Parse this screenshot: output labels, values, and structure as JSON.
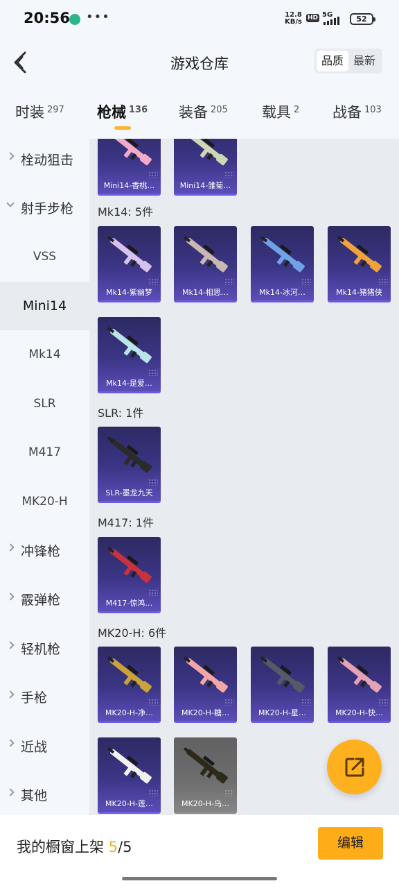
{
  "status_bar": {
    "time": "20:56",
    "speed_value": "12.8",
    "speed_unit": "KB/s",
    "hd": "HD",
    "network": "5G",
    "battery": "52"
  },
  "header": {
    "title": "游戏仓库",
    "sort_options": [
      "品质",
      "最新"
    ],
    "sort_selected": "品质"
  },
  "tabs": [
    {
      "label": "时装",
      "count": "297"
    },
    {
      "label": "枪械",
      "count": "136"
    },
    {
      "label": "装备",
      "count": "205"
    },
    {
      "label": "载具",
      "count": "2"
    },
    {
      "label": "战备",
      "count": "103"
    }
  ],
  "active_tab": "枪械",
  "sidebar": {
    "items": [
      {
        "label": "栓动狙击",
        "type": "category",
        "expanded": false
      },
      {
        "label": "射手步枪",
        "type": "category",
        "expanded": true
      },
      {
        "label": "VSS",
        "type": "sub"
      },
      {
        "label": "Mini14",
        "type": "sub",
        "selected": true
      },
      {
        "label": "Mk14",
        "type": "sub"
      },
      {
        "label": "SLR",
        "type": "sub"
      },
      {
        "label": "M417",
        "type": "sub"
      },
      {
        "label": "MK20-H",
        "type": "sub"
      },
      {
        "label": "冲锋枪",
        "type": "category",
        "expanded": false
      },
      {
        "label": "霰弹枪",
        "type": "category",
        "expanded": false
      },
      {
        "label": "轻机枪",
        "type": "category",
        "expanded": false
      },
      {
        "label": "手枪",
        "type": "category",
        "expanded": false
      },
      {
        "label": "近战",
        "type": "category",
        "expanded": false
      },
      {
        "label": "其他",
        "type": "category",
        "expanded": false
      }
    ]
  },
  "groups": [
    {
      "title": "",
      "items": [
        {
          "label": "Mini14-香桃…",
          "color": "#f3a9c7"
        },
        {
          "label": "Mini14-雏菊…",
          "color": "#cfd6b6"
        }
      ]
    },
    {
      "title": "Mk14: 5件",
      "items": [
        {
          "label": "Mk14-紫幽梦",
          "color": "#d7c2ee"
        },
        {
          "label": "Mk14-相思…",
          "color": "#c9b8b2"
        },
        {
          "label": "Mk14-冰河…",
          "color": "#6fa3e6"
        },
        {
          "label": "Mk14-猪猪侠",
          "color": "#f0a23c"
        },
        {
          "label": "Mk14-是爱…",
          "color": "#b8e4ea"
        }
      ]
    },
    {
      "title": "SLR: 1件",
      "items": [
        {
          "label": "SLR-墨龙九天",
          "color": "#2b2b2b"
        }
      ]
    },
    {
      "title": "M417: 1件",
      "items": [
        {
          "label": "M417-惊鸿…",
          "color": "#c7323d"
        }
      ]
    },
    {
      "title": "MK20-H: 6件",
      "items": [
        {
          "label": "MK20-H-净…",
          "color": "#c9a23a"
        },
        {
          "label": "MK20-H-糖…",
          "color": "#f2a6a6"
        },
        {
          "label": "MK20-H-星…",
          "color": "#555a66"
        },
        {
          "label": "MK20-H-快…",
          "color": "#e6a2b5"
        },
        {
          "label": "MK20-H-莲…",
          "color": "#f1f1f1"
        },
        {
          "label": "MK20-H-乌…",
          "color": "#2e2a1a",
          "grey": true
        }
      ]
    }
  ],
  "bottom_bar": {
    "text": "我的橱窗上架",
    "current": "5",
    "total": "/5",
    "edit_label": "编辑"
  },
  "colors": {
    "accent": "#ffb01f",
    "card_bg": "#3b3585",
    "page_bg": "#e8ebf0"
  }
}
